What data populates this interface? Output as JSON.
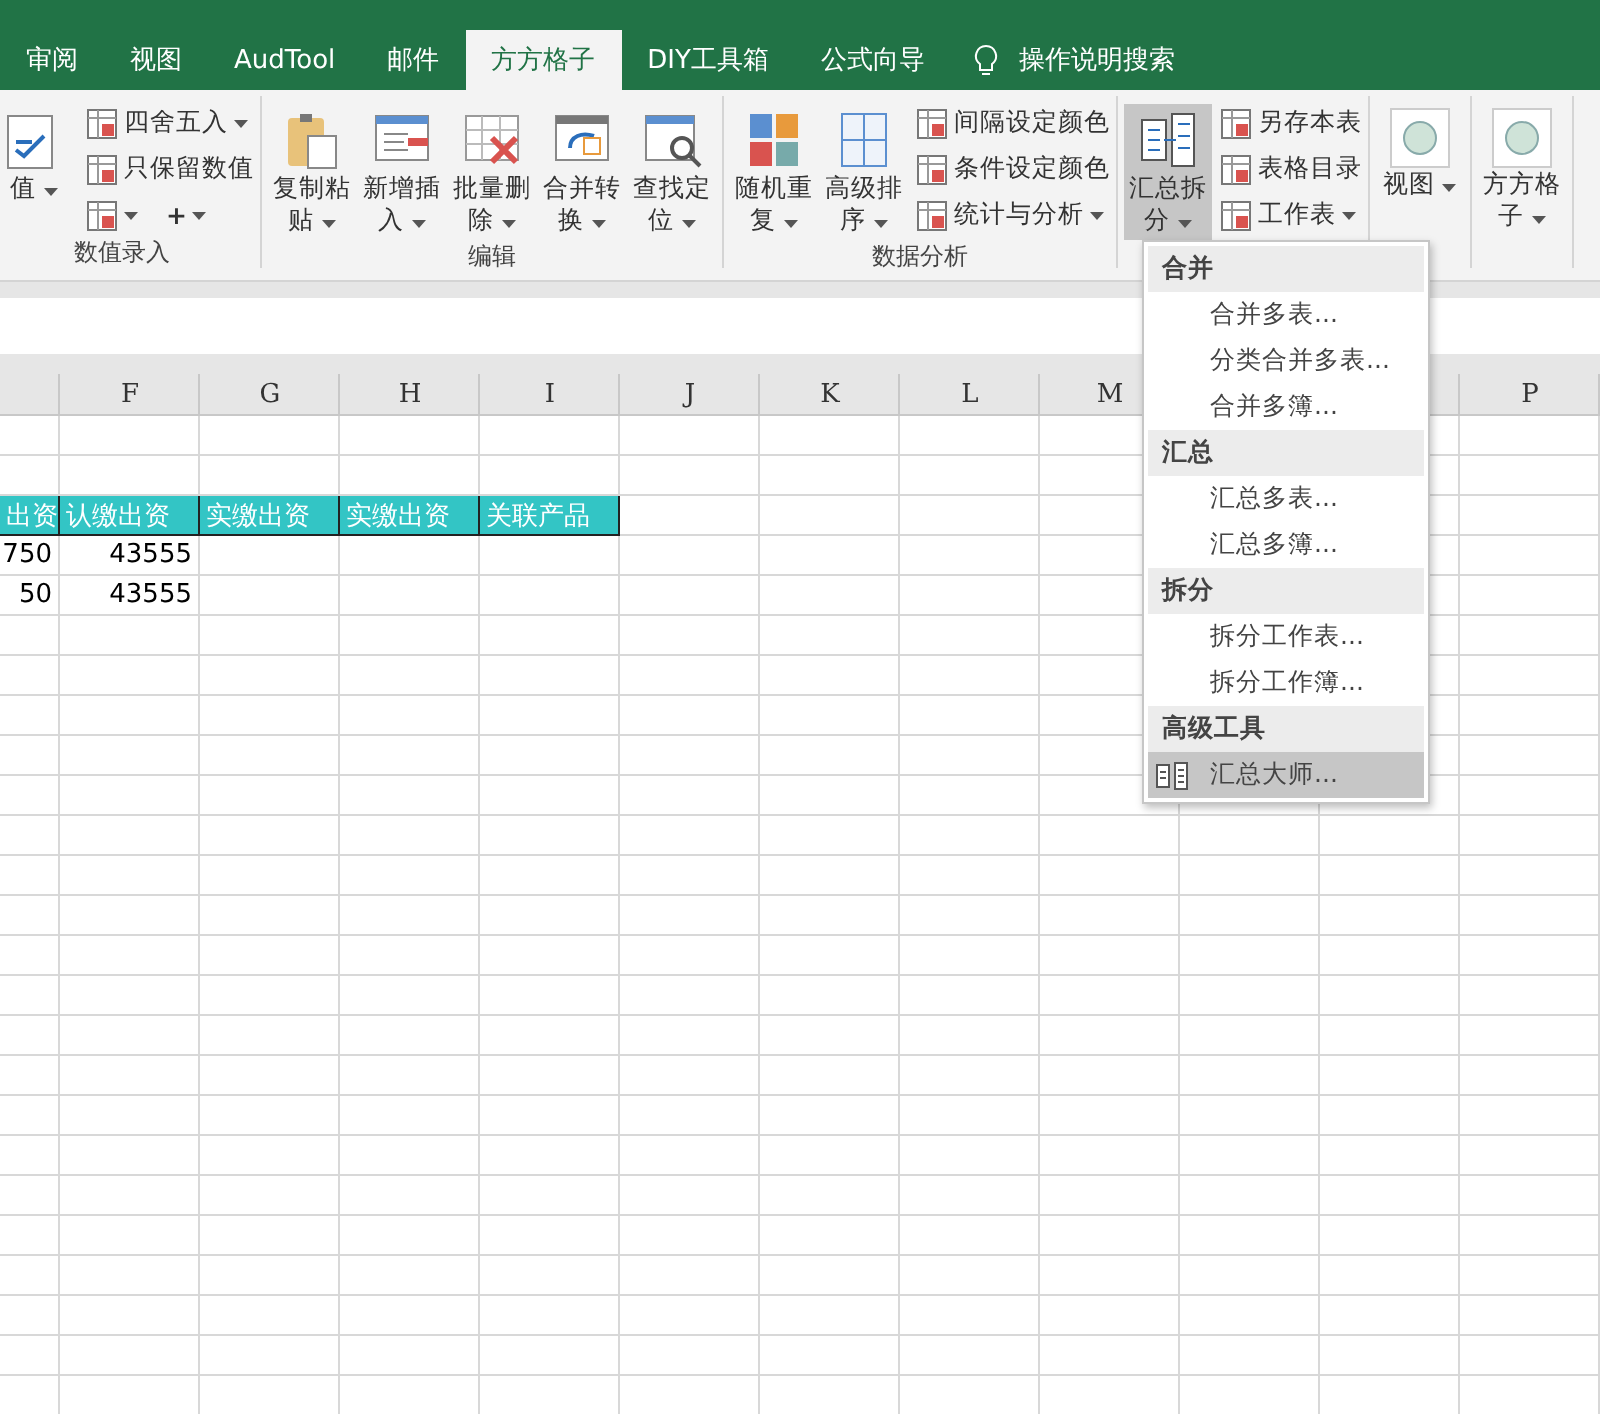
{
  "tabs": [
    {
      "label": "审阅",
      "selected": false
    },
    {
      "label": "视图",
      "selected": false
    },
    {
      "label": "AudTool",
      "selected": false
    },
    {
      "label": "邮件",
      "selected": false
    },
    {
      "label": "方方格子",
      "selected": true
    },
    {
      "label": "DIY工具箱",
      "selected": false
    },
    {
      "label": "公式向导",
      "selected": false
    }
  ],
  "search": {
    "placeholder": "操作说明搜索"
  },
  "groups": [
    {
      "label": "数值录入",
      "large": [
        {
          "label": "值",
          "dropdown": true,
          "pressed": false
        }
      ],
      "small": [
        {
          "label": "四舍五入",
          "dropdown": true
        },
        {
          "label": "只保留数值",
          "dropdown": false
        },
        {
          "dropdown": true,
          "kind": "edit"
        },
        {
          "label": "+",
          "dropdown": true,
          "kind": "plus"
        }
      ]
    },
    {
      "label": "编辑",
      "large": [
        {
          "label": "复制粘贴",
          "dropdown": true,
          "pressed": false
        },
        {
          "label": "新增插入",
          "dropdown": true,
          "pressed": false
        },
        {
          "label": "批量删除",
          "dropdown": true,
          "pressed": false
        },
        {
          "label": "合并转换",
          "dropdown": true,
          "pressed": false
        },
        {
          "label": "查找定位",
          "dropdown": true,
          "pressed": false
        }
      ]
    },
    {
      "label": "数据分析",
      "large": [
        {
          "label": "随机重复",
          "dropdown": true,
          "pressed": false
        },
        {
          "label": "高级排序",
          "dropdown": true,
          "pressed": false
        }
      ],
      "small": [
        {
          "label": "间隔设定颜色",
          "dropdown": false
        },
        {
          "label": "条件设定颜色",
          "dropdown": false
        },
        {
          "label": "统计与分析",
          "dropdown": true
        }
      ]
    },
    {
      "large": [
        {
          "label": "汇总拆分",
          "dropdown": true,
          "pressed": true
        }
      ],
      "small": [
        {
          "label": "另存本表",
          "dropdown": false
        },
        {
          "label": "表格目录",
          "dropdown": false
        },
        {
          "label": "工作表",
          "dropdown": true
        }
      ]
    },
    {
      "large": [
        {
          "label": "视图",
          "dropdown": true,
          "pressed": false,
          "kind": "circle"
        }
      ]
    },
    {
      "large": [
        {
          "label": "方方格子",
          "dropdown": true,
          "pressed": false,
          "kind": "circle"
        }
      ]
    }
  ],
  "columns": [
    "F",
    "G",
    "H",
    "I",
    "J",
    "K",
    "L",
    "M",
    "P"
  ],
  "header_row": [
    "出资",
    "认缴出资",
    "实缴出资",
    "实缴出资",
    "关联产品"
  ],
  "data_rows": [
    [
      "750",
      "43555"
    ],
    [
      "50",
      "43555"
    ]
  ],
  "menu": {
    "sections": [
      {
        "title": "合并",
        "items": [
          {
            "label": "合并多表...",
            "hovered": false
          },
          {
            "label": "分类合并多表...",
            "hovered": false
          },
          {
            "label": "合并多簿...",
            "hovered": false
          }
        ]
      },
      {
        "title": "汇总",
        "items": [
          {
            "label": "汇总多表...",
            "hovered": false
          },
          {
            "label": "汇总多簿...",
            "hovered": false
          }
        ]
      },
      {
        "title": "拆分",
        "items": [
          {
            "label": "拆分工作表...",
            "hovered": false
          },
          {
            "label": "拆分工作簿...",
            "hovered": false
          }
        ]
      },
      {
        "title": "高级工具",
        "items": [
          {
            "label": "汇总大师...",
            "hovered": true,
            "icon": true
          }
        ]
      }
    ]
  }
}
